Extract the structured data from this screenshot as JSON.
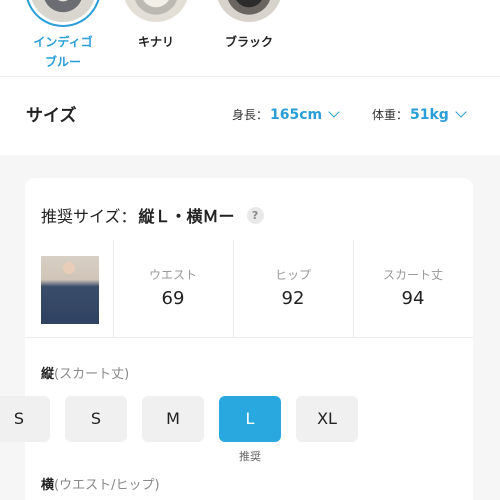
{
  "colors": {
    "items": [
      {
        "label": "インディゴ\nブルー",
        "selected": true
      },
      {
        "label": "キナリ",
        "selected": false
      },
      {
        "label": "ブラック",
        "selected": false
      }
    ]
  },
  "size_section": {
    "title": "サイズ",
    "height_filter": {
      "label": "身長：",
      "value": "165cm"
    },
    "weight_filter": {
      "label": "体重：",
      "value": "51kg"
    }
  },
  "recommendation": {
    "label": "推奨サイズ：",
    "value": "縦Ｌ・横Ｍー",
    "help": "?"
  },
  "measurements": [
    {
      "label": "ウエスト",
      "value": "69"
    },
    {
      "label": "ヒップ",
      "value": "92"
    },
    {
      "label": "スカート丈",
      "value": "94"
    }
  ],
  "length_group": {
    "label_bold": "縦",
    "label_rest": "(スカート丈)",
    "sizes": [
      "S",
      "S",
      "M",
      "L",
      "XL"
    ],
    "selected_index": 3,
    "recommended_tag": "推奨"
  },
  "width_group": {
    "label_bold": "横",
    "label_rest": "(ウエスト/ヒップ)"
  },
  "theme": {
    "accent": "#2a9ed8",
    "selected_bg": "#29a8e0"
  }
}
